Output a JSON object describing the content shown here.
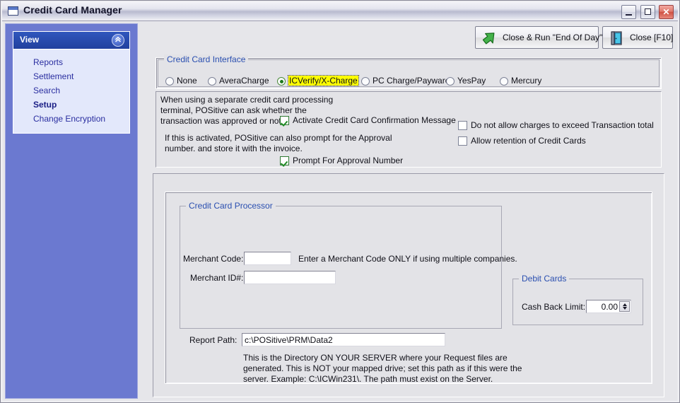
{
  "window": {
    "title": "Credit Card Manager",
    "icon": "window-icon",
    "controls": {
      "minimize": "minimize-button",
      "maximize": "maximize-button",
      "close": "✕"
    }
  },
  "sidebar": {
    "header": "View",
    "collapse_glyph": "«",
    "items": [
      {
        "label": "Reports",
        "active": false
      },
      {
        "label": "Settlement",
        "active": false
      },
      {
        "label": "Search",
        "active": false
      },
      {
        "label": "Setup",
        "active": true
      },
      {
        "label": "Change Encryption",
        "active": false
      }
    ]
  },
  "toolbar": {
    "end_of_day_label": "Close & Run \"End Of Day\"",
    "close_label": "Close [F10]"
  },
  "interface_group": {
    "legend": "Credit Card Interface",
    "options": [
      {
        "label": "None",
        "selected": false,
        "highlight": false
      },
      {
        "label": "AveraCharge",
        "selected": false,
        "highlight": false
      },
      {
        "label": "ICVerify/X-Charge",
        "selected": true,
        "highlight": true
      },
      {
        "label": "PC Charge/Payware",
        "selected": false,
        "highlight": false
      },
      {
        "label": "YesPay",
        "selected": false,
        "highlight": false
      },
      {
        "label": "Mercury",
        "selected": false,
        "highlight": false
      }
    ]
  },
  "options_panel": {
    "note1_line1": "When using a separate credit card processing",
    "note1_line2": "terminal, POSitive can ask whether the",
    "note1_line3": "transaction was approved or not.",
    "confirm_checkbox": {
      "label": "Activate Credit Card Confirmation Message",
      "checked": true
    },
    "note2_line1": "If this is activated, POSitive can also prompt for the Approval",
    "note2_line2": "number. and store it with the invoice.",
    "approval_checkbox": {
      "label": "Prompt For Approval Number",
      "checked": true
    },
    "no_exceed_checkbox": {
      "label": "Do not allow charges to exceed Transaction total",
      "checked": false
    },
    "retention_checkbox": {
      "label": "Allow retention of Credit Cards",
      "checked": false
    }
  },
  "processor_group": {
    "legend": "Credit Card Processor",
    "merchant_code_label": "Merchant Code:",
    "merchant_code_value": "",
    "merchant_code_hint": "Enter a Merchant Code ONLY if using multiple companies.",
    "merchant_id_label": "Merchant ID#:",
    "merchant_id_value": ""
  },
  "debit_group": {
    "legend": "Debit Cards",
    "cash_back_label": "Cash Back Limit:",
    "cash_back_value": "0.00"
  },
  "report_path": {
    "label": "Report Path:",
    "value": "c:\\POSitive\\PRM\\Data2",
    "help_line1": "This is the Directory ON YOUR SERVER where your Request files are",
    "help_line2": "generated.  This is NOT your mapped drive; set this path as if this were the",
    "help_line3": "server.  Example:  C:\\ICWin231\\.  The path must exist on the Server."
  },
  "colors": {
    "sidebar_blue": "#6b79d0",
    "nav_header_blue": "#21409e",
    "legend_blue": "#2a4fb0",
    "highlight_yellow": "#ffff00",
    "check_green": "#1e8a24",
    "close_red": "#cf5244"
  }
}
